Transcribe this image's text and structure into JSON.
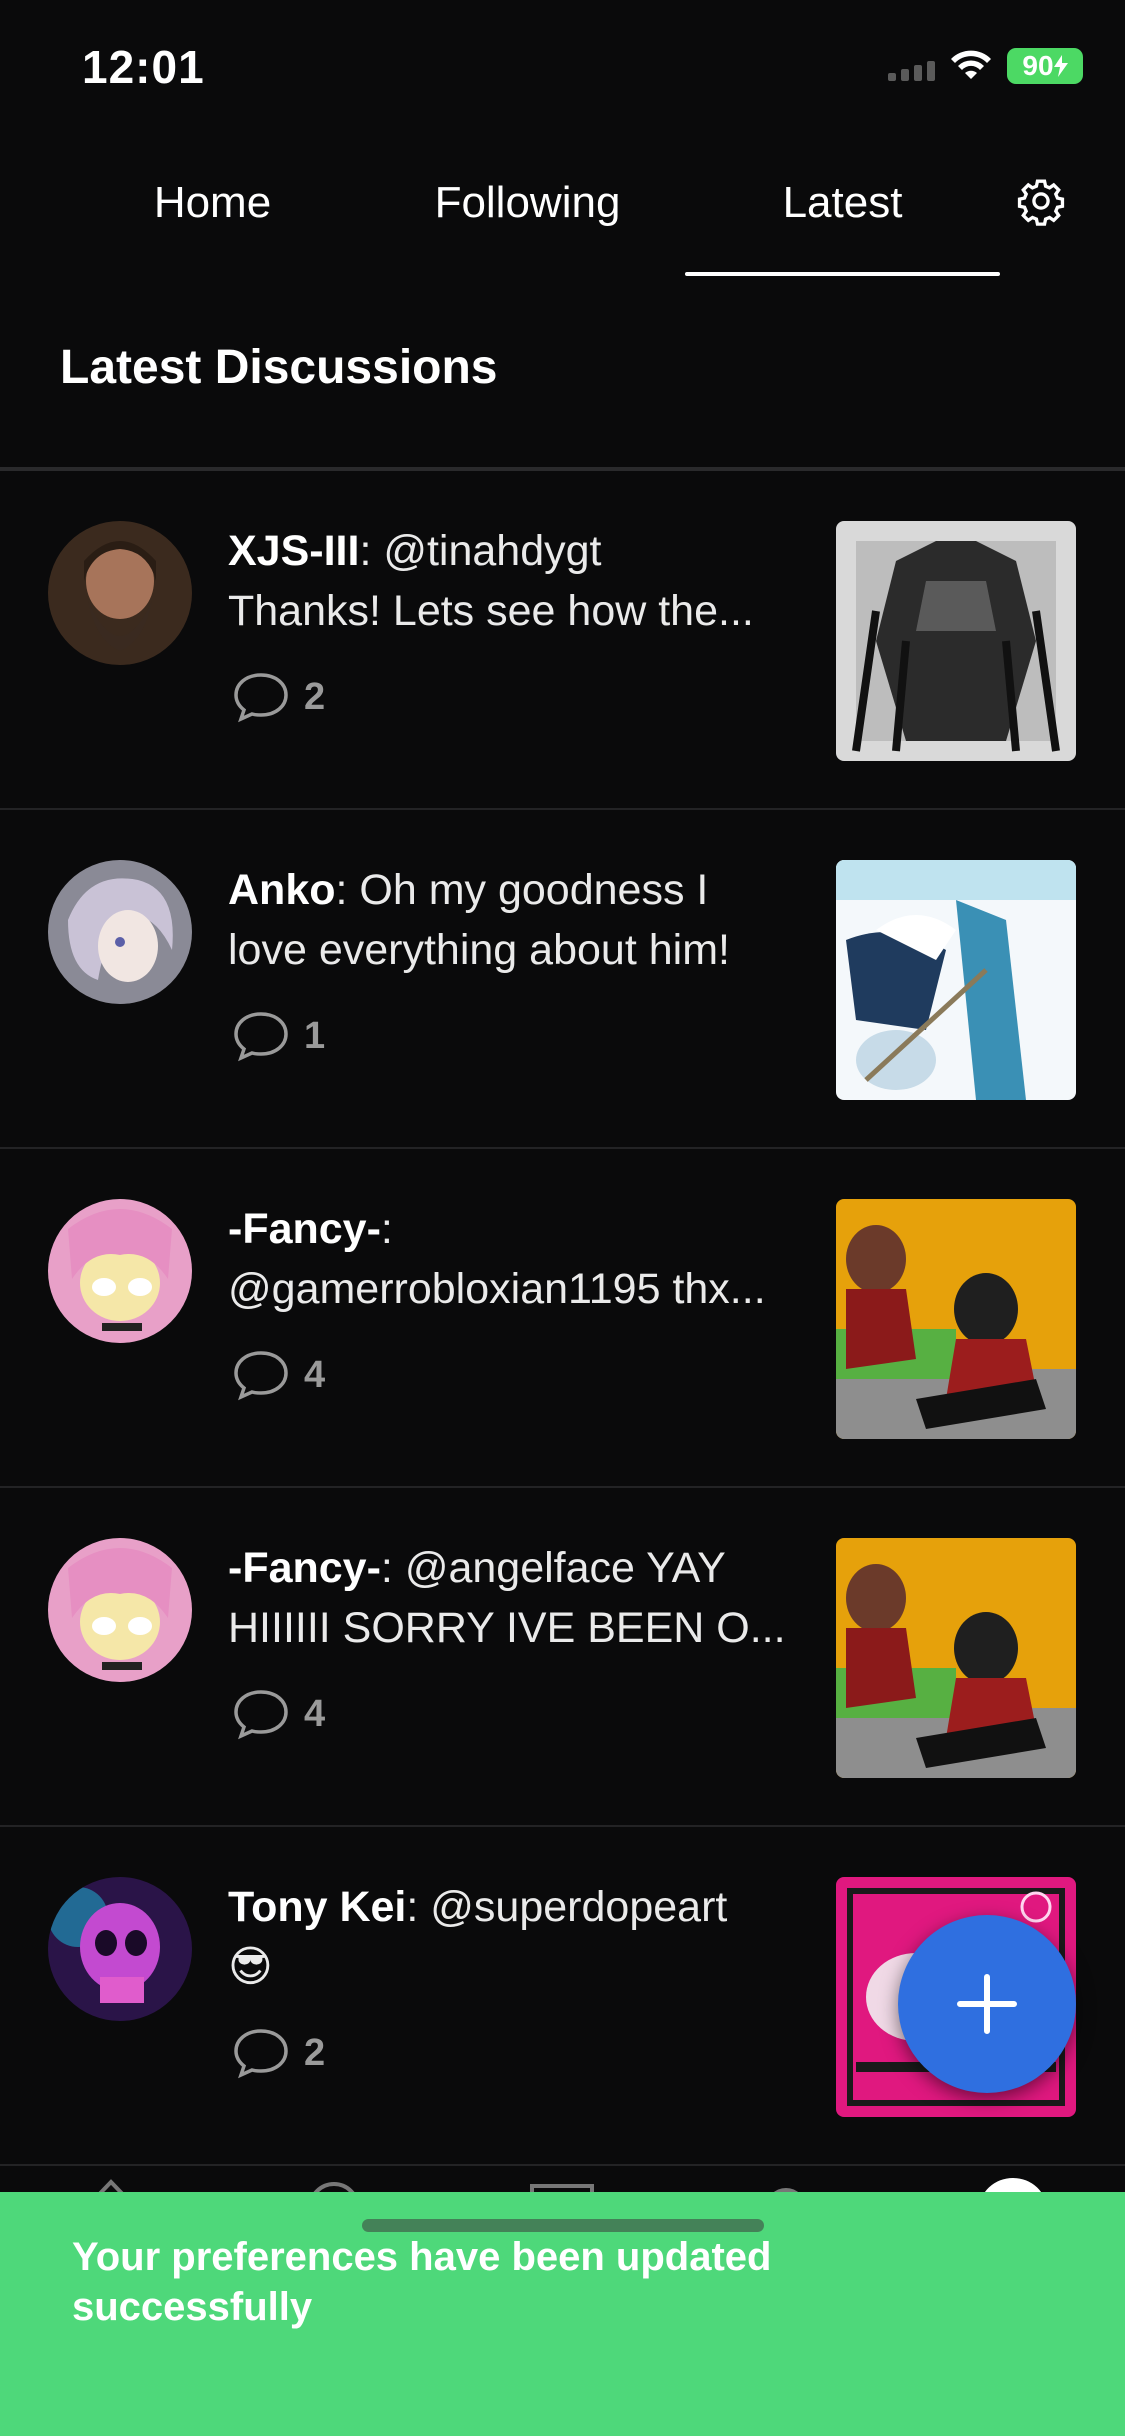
{
  "status_bar": {
    "time": "12:01",
    "battery": "90"
  },
  "tabs": [
    {
      "label": "Home",
      "active": false
    },
    {
      "label": "Following",
      "active": false
    },
    {
      "label": "Latest",
      "active": true
    }
  ],
  "section_title": "Latest Discussions",
  "discussions": [
    {
      "author": "XJS-III",
      "line1": ": @tinahdygt",
      "line2": "Thanks! Lets see how the...",
      "comments": "2"
    },
    {
      "author": "Anko",
      "line1": ": Oh my goodness I",
      "line2": "love everything about him!",
      "comments": "1"
    },
    {
      "author": "-Fancy-",
      "line1": ":",
      "line2": "@gamerrobloxian1195 thx...",
      "comments": "4"
    },
    {
      "author": "-Fancy-",
      "line1": ": @angelface YAY",
      "line2": "HIIIIII SORRY IVE BEEN O...",
      "comments": "4"
    },
    {
      "author": "Tony Kei",
      "line1": ": @superdopeart",
      "line2": "😎",
      "comments": "2"
    }
  ],
  "fab": {
    "icon": "plus-icon",
    "color": "#2f6fe0"
  },
  "toast": {
    "message": "Your preferences have been updated successfully",
    "color": "#4ed87a"
  },
  "colors": {
    "background": "#0a0a0b",
    "accent": "#2f6fe0",
    "success": "#4ed87a"
  }
}
